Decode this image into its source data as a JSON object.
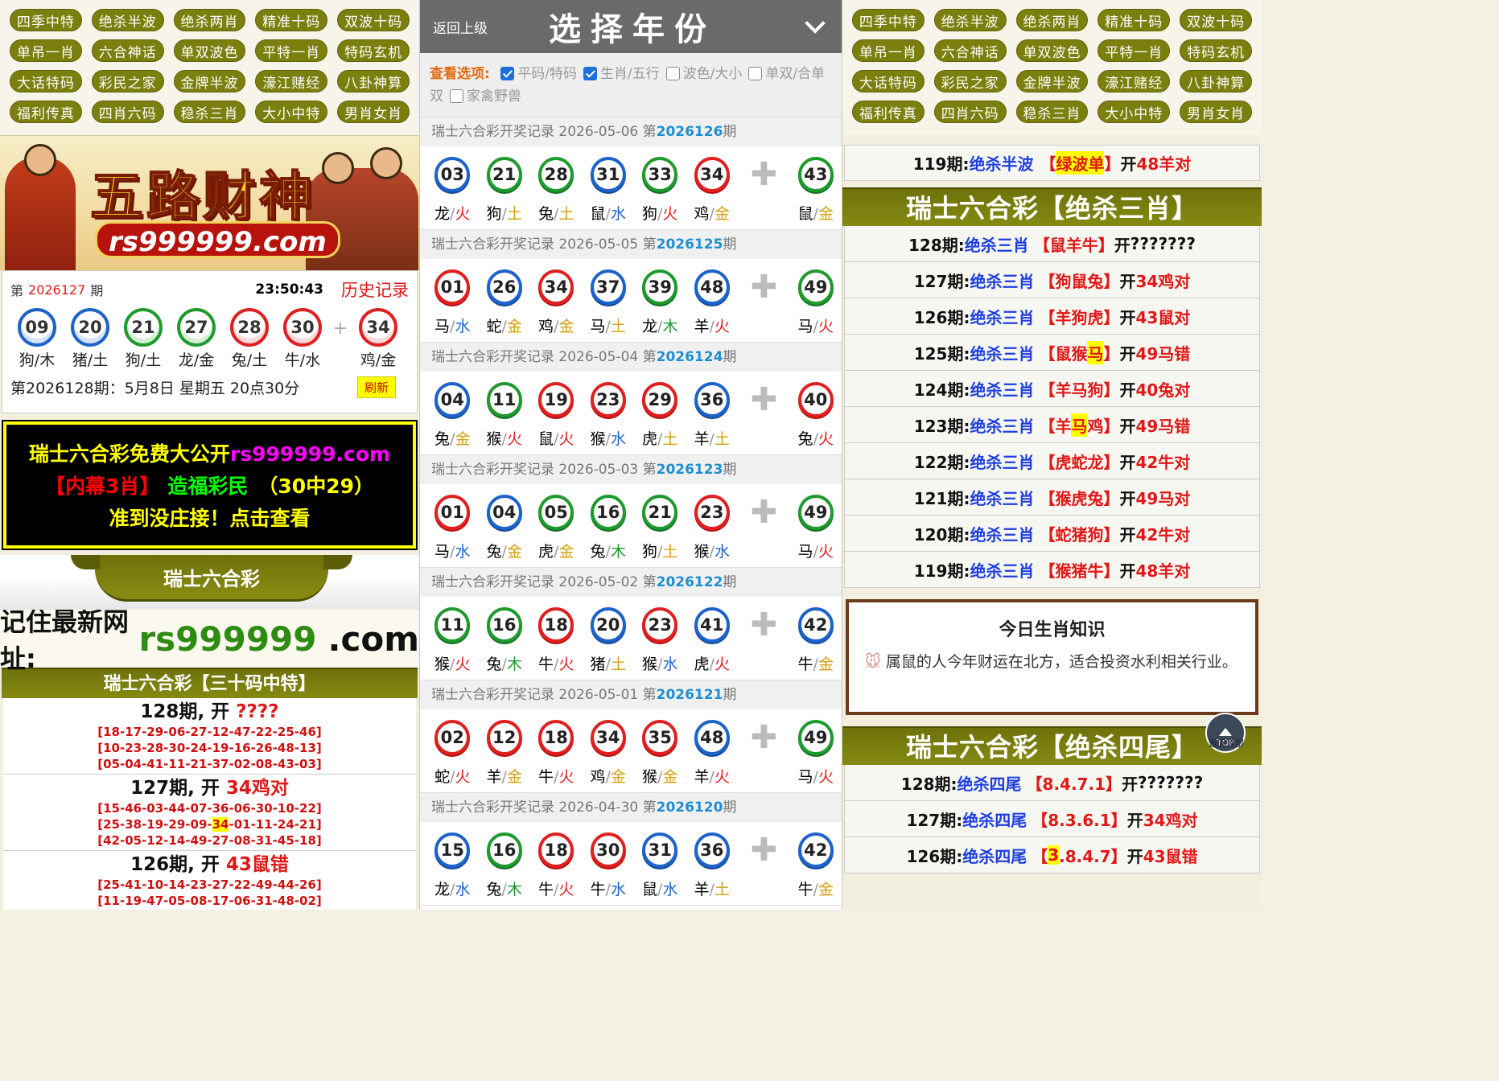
{
  "nav": [
    "四季中特",
    "绝杀半波",
    "绝杀两肖",
    "精准十码",
    "双波十码",
    "单吊一肖",
    "六合神话",
    "单双波色",
    "平特一肖",
    "特码玄机",
    "大话特码",
    "彩民之家",
    "金牌半波",
    "濠江赌经",
    "八卦神算",
    "福利传真",
    "四肖六码",
    "稳杀三肖",
    "大小中特",
    "男肖女肖"
  ],
  "banner": {
    "title": "五路财神",
    "url": "rs999999.com"
  },
  "draw": {
    "label_pre": "第",
    "period": "2026127",
    "label_post": "期",
    "time": "23:50:43",
    "history": "历史记录",
    "balls": [
      {
        "n": "09",
        "c": "blue",
        "z": "狗/木"
      },
      {
        "n": "20",
        "c": "blue",
        "z": "猪/土"
      },
      {
        "n": "21",
        "c": "green",
        "z": "狗/土"
      },
      {
        "n": "27",
        "c": "green",
        "z": "龙/金"
      },
      {
        "n": "28",
        "c": "red",
        "z": "兔/土"
      },
      {
        "n": "30",
        "c": "red",
        "z": "牛/水"
      }
    ],
    "special": {
      "n": "34",
      "c": "red",
      "z": "鸡/金"
    },
    "plus": "+",
    "next": "第2026128期：5月8日 星期五 20点30分",
    "refresh": "刷新"
  },
  "ad": {
    "l1a": "瑞士六合彩免费大公开",
    "l1b": "rs999999.com",
    "l2a": "【内幕3肖】",
    "l2b": "造福彩民",
    "l2c": "（30中29）",
    "l3": "准到没庄接！点击查看"
  },
  "ribbon": "瑞士六合彩",
  "site": {
    "a": "记住最新网址:",
    "b": "rs999999",
    "c": ".com"
  },
  "left_section": {
    "title": "瑞士六合彩【三十码中特】",
    "items": [
      {
        "period": "128期",
        "sep": ", 开 ",
        "res": "????",
        "groups": [
          [
            "18-17-29-06-27-12-47-22-25-46"
          ],
          [
            "10-23-28-30-24-19-16-26-48-13"
          ],
          [
            "05-04-41-11-21-37-02-08-43-03"
          ]
        ]
      },
      {
        "period": "127期",
        "sep": ", 开 ",
        "res": "34鸡对",
        "groups": [
          [
            "15-46-03-44-07-36-06-30-10-22"
          ],
          [
            "25-38-19-29-09-",
            "34",
            "-01-11-24-21"
          ],
          [
            "42-05-12-14-49-27-08-31-45-18"
          ]
        ]
      },
      {
        "period": "126期",
        "sep": ", 开 ",
        "res": "43鼠错",
        "groups": [
          [
            "25-41-10-14-23-27-22-49-44-26"
          ],
          [
            "11-19-47-05-08-17-06-31-48-02"
          ]
        ]
      }
    ]
  },
  "mid": {
    "back": "返回上级",
    "title": "选择年份",
    "options_label": "查看选项:",
    "options": [
      {
        "t": "平码/特码",
        "on": true
      },
      {
        "t": "生肖/五行",
        "on": true
      },
      {
        "t": "波色/大小",
        "on": false
      },
      {
        "t": "单双/合单双",
        "on": false
      },
      {
        "t": "家禽野兽",
        "on": false
      }
    ],
    "records": [
      {
        "title": "瑞士六合彩开奖记录 2026-05-06 第",
        "p": "2026126",
        "s": "期",
        "balls": [
          [
            "03",
            "blue",
            "龙",
            "火"
          ],
          [
            "21",
            "green",
            "狗",
            "土"
          ],
          [
            "28",
            "green",
            "兔",
            "土"
          ],
          [
            "31",
            "blue",
            "鼠",
            "水"
          ],
          [
            "33",
            "green",
            "狗",
            "火"
          ],
          [
            "34",
            "red",
            "鸡",
            "金"
          ]
        ],
        "sp": [
          "43",
          "green",
          "鼠",
          "金"
        ]
      },
      {
        "title": "瑞士六合彩开奖记录 2026-05-05 第",
        "p": "2026125",
        "s": "期",
        "balls": [
          [
            "01",
            "red",
            "马",
            "水"
          ],
          [
            "26",
            "blue",
            "蛇",
            "金"
          ],
          [
            "34",
            "red",
            "鸡",
            "金"
          ],
          [
            "37",
            "blue",
            "马",
            "土"
          ],
          [
            "39",
            "green",
            "龙",
            "木"
          ],
          [
            "48",
            "blue",
            "羊",
            "火"
          ]
        ],
        "sp": [
          "49",
          "green",
          "马",
          "火"
        ]
      },
      {
        "title": "瑞士六合彩开奖记录 2026-05-04 第",
        "p": "2026124",
        "s": "期",
        "balls": [
          [
            "04",
            "blue",
            "兔",
            "金"
          ],
          [
            "11",
            "green",
            "猴",
            "火"
          ],
          [
            "19",
            "red",
            "鼠",
            "火"
          ],
          [
            "23",
            "red",
            "猴",
            "水"
          ],
          [
            "29",
            "red",
            "虎",
            "土"
          ],
          [
            "36",
            "blue",
            "羊",
            "土"
          ]
        ],
        "sp": [
          "40",
          "red",
          "兔",
          "火"
        ]
      },
      {
        "title": "瑞士六合彩开奖记录 2026-05-03 第",
        "p": "2026123",
        "s": "期",
        "balls": [
          [
            "01",
            "red",
            "马",
            "水"
          ],
          [
            "04",
            "blue",
            "兔",
            "金"
          ],
          [
            "05",
            "green",
            "虎",
            "金"
          ],
          [
            "16",
            "green",
            "兔",
            "木"
          ],
          [
            "21",
            "green",
            "狗",
            "土"
          ],
          [
            "23",
            "red",
            "猴",
            "水"
          ]
        ],
        "sp": [
          "49",
          "green",
          "马",
          "火"
        ]
      },
      {
        "title": "瑞士六合彩开奖记录 2026-05-02 第",
        "p": "2026122",
        "s": "期",
        "balls": [
          [
            "11",
            "green",
            "猴",
            "火"
          ],
          [
            "16",
            "green",
            "兔",
            "木"
          ],
          [
            "18",
            "red",
            "牛",
            "火"
          ],
          [
            "20",
            "blue",
            "猪",
            "土"
          ],
          [
            "23",
            "red",
            "猴",
            "水"
          ],
          [
            "41",
            "blue",
            "虎",
            "火"
          ]
        ],
        "sp": [
          "42",
          "blue",
          "牛",
          "金"
        ]
      },
      {
        "title": "瑞士六合彩开奖记录 2026-05-01 第",
        "p": "2026121",
        "s": "期",
        "balls": [
          [
            "02",
            "red",
            "蛇",
            "火"
          ],
          [
            "12",
            "red",
            "羊",
            "金"
          ],
          [
            "18",
            "red",
            "牛",
            "火"
          ],
          [
            "34",
            "red",
            "鸡",
            "金"
          ],
          [
            "35",
            "red",
            "猴",
            "金"
          ],
          [
            "48",
            "blue",
            "羊",
            "火"
          ]
        ],
        "sp": [
          "49",
          "green",
          "马",
          "火"
        ]
      },
      {
        "title": "瑞士六合彩开奖记录 2026-04-30 第",
        "p": "2026120",
        "s": "期",
        "balls": [
          [
            "15",
            "blue",
            "龙",
            "水"
          ],
          [
            "16",
            "green",
            "兔",
            "木"
          ],
          [
            "18",
            "red",
            "牛",
            "火"
          ],
          [
            "30",
            "red",
            "牛",
            "水"
          ],
          [
            "31",
            "blue",
            "鼠",
            "水"
          ],
          [
            "36",
            "blue",
            "羊",
            "土"
          ]
        ],
        "sp": [
          "42",
          "blue",
          "牛",
          "金"
        ]
      }
    ]
  },
  "right": {
    "top_row": {
      "p": "119期:",
      "k": "绝杀半波",
      "l": "【",
      "v": "绿波单",
      "r": "】",
      "o": "开",
      "res": "48羊对"
    },
    "sec1": {
      "title": "瑞士六合彩【绝杀三肖】",
      "rows": [
        {
          "p": "128期:",
          "k": "绝杀三肖",
          "v": "【鼠羊牛】",
          "o": "开",
          "res": "???????",
          "plain": true
        },
        {
          "p": "127期:",
          "k": "绝杀三肖",
          "v": "【狗鼠兔】",
          "o": "开",
          "res": "34鸡对"
        },
        {
          "p": "126期:",
          "k": "绝杀三肖",
          "v": "【羊狗虎】",
          "o": "开",
          "res": "43鼠对"
        },
        {
          "p": "125期:",
          "k": "绝杀三肖",
          "v1": "【鼠猴",
          "hl": "马",
          "v2": "】",
          "o": "开",
          "res": "49马错"
        },
        {
          "p": "124期:",
          "k": "绝杀三肖",
          "v": "【羊马狗】",
          "o": "开",
          "res": "40兔对"
        },
        {
          "p": "123期:",
          "k": "绝杀三肖",
          "v1": "【羊",
          "hl": "马",
          "v2": "鸡】",
          "o": "开",
          "res": "49马错"
        },
        {
          "p": "122期:",
          "k": "绝杀三肖",
          "v": "【虎蛇龙】",
          "o": "开",
          "res": "42牛对"
        },
        {
          "p": "121期:",
          "k": "绝杀三肖",
          "v": "【猴虎兔】",
          "o": "开",
          "res": "49马对"
        },
        {
          "p": "120期:",
          "k": "绝杀三肖",
          "v": "【蛇猪狗】",
          "o": "开",
          "res": "42牛对"
        },
        {
          "p": "119期:",
          "k": "绝杀三肖",
          "v": "【猴猪牛】",
          "o": "开",
          "res": "48羊对"
        }
      ]
    },
    "know": {
      "title": "今日生肖知识",
      "body": "属鼠的人今年财运在北方，适合投资水利相关行业。"
    },
    "totop": {
      "a": "TOP",
      "b": "返回顶部"
    },
    "sec2": {
      "title": "瑞士六合彩【绝杀四尾】",
      "rows": [
        {
          "p": "128期:",
          "k": "绝杀四尾",
          "v": "【8.4.7.1】",
          "o": "开",
          "res": "???????",
          "plain": true
        },
        {
          "p": "127期:",
          "k": "绝杀四尾",
          "v": "【8.3.6.1】",
          "o": "开",
          "res": "34鸡对"
        },
        {
          "p": "126期:",
          "k": "绝杀四尾",
          "v1": "【",
          "hl": "3",
          "v2": ".8.4.7】",
          "o": "开",
          "res": "43鼠错"
        }
      ]
    }
  }
}
